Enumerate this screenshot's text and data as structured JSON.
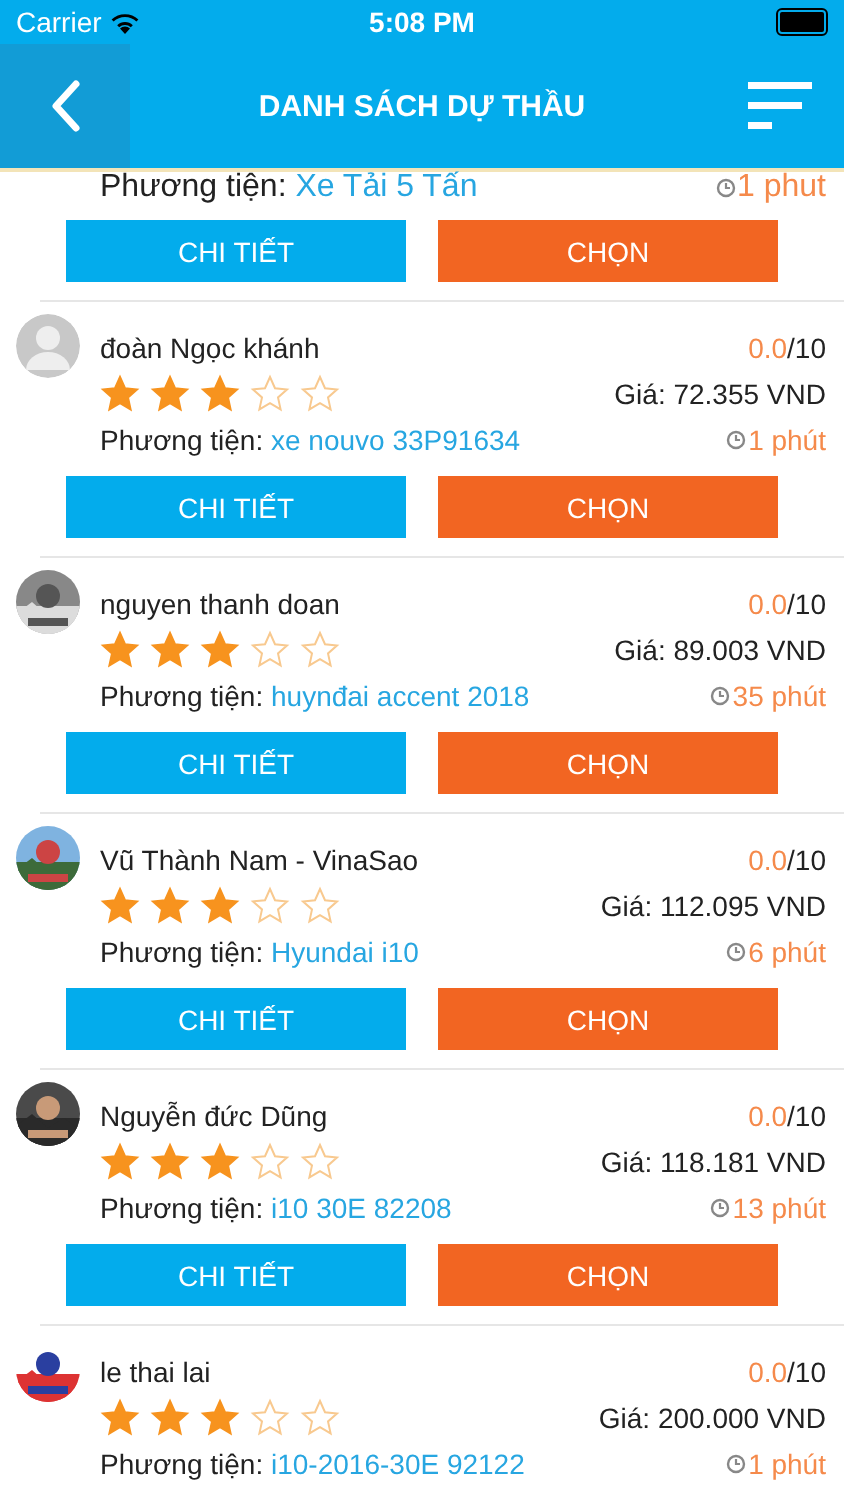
{
  "status_bar": {
    "carrier": "Carrier",
    "time": "5:08 PM"
  },
  "header": {
    "title": "DANH SÁCH DỰ THẦU"
  },
  "bids": [
    {
      "vehicle_label": "Phương tiện:",
      "vehicle": "Xe Tải 5 Tấn",
      "time": "1 phut",
      "detail_button": "CHI TIẾT",
      "choose_button": "CHỌN"
    },
    {
      "avatar": {
        "kind": "placeholder"
      },
      "name": "đoàn Ngọc khánh",
      "score": "0.0",
      "score_max": "/10",
      "stars": 3,
      "price": "Giá: 72.355 VND",
      "vehicle_label": "Phương tiện:",
      "vehicle": "xe nouvo 33P91634",
      "time": "1 phút",
      "detail_button": "CHI TIẾT",
      "choose_button": "CHỌN"
    },
    {
      "name": "nguyen thanh doan",
      "score": "0.0",
      "score_max": "/10",
      "stars": 3,
      "price": "Giá: 89.003 VND",
      "vehicle_label": "Phương tiện:",
      "vehicle": "huynđai accent 2018",
      "time": "35 phút",
      "detail_button": "CHI TIẾT",
      "choose_button": "CHỌN"
    },
    {
      "name": "Vũ Thành Nam - VinaSao",
      "score": "0.0",
      "score_max": "/10",
      "stars": 3,
      "price": "Giá: 112.095 VND",
      "vehicle_label": "Phương tiện:",
      "vehicle": "Hyundai i10",
      "time": "6 phút",
      "detail_button": "CHI TIẾT",
      "choose_button": "CHỌN"
    },
    {
      "name": "Nguyễn đức Dũng",
      "score": "0.0",
      "score_max": "/10",
      "stars": 3,
      "price": "Giá: 118.181 VND",
      "vehicle_label": "Phương tiện:",
      "vehicle": "i10 30E 82208",
      "time": "13 phút",
      "detail_button": "CHI TIẾT",
      "choose_button": "CHỌN"
    },
    {
      "name": "le thai lai",
      "score": "0.0",
      "score_max": "/10",
      "stars": 3,
      "price": "Giá: 200.000 VND",
      "vehicle_label": "Phương tiện:",
      "vehicle": "i10-2016-30E 92122",
      "time": "1 phút"
    }
  ]
}
